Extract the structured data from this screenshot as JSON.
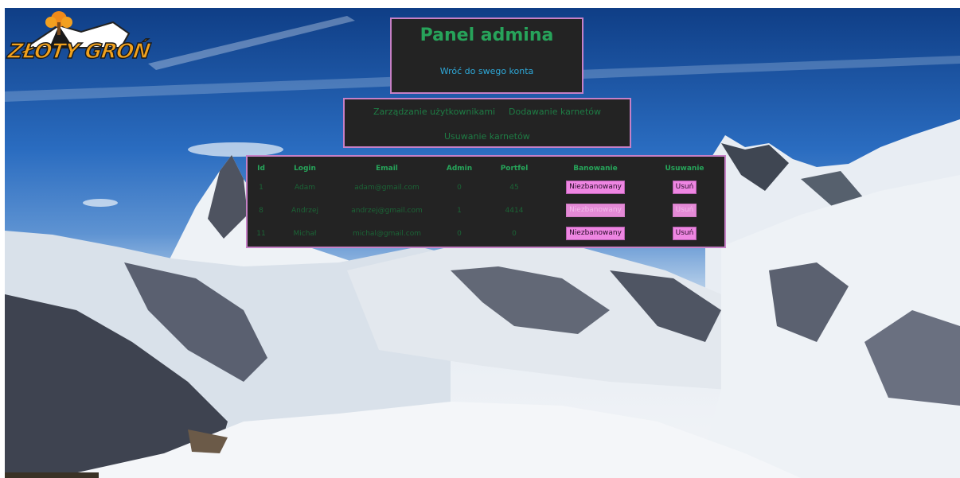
{
  "brand": {
    "logo_text": "ZŁOTY GROŃ"
  },
  "header": {
    "title": "Panel admina",
    "back_link": "Wróć do swego konta"
  },
  "nav": {
    "manage_users": "Zarządzanie użytkownikami",
    "add_passes": "Dodawanie karnetów",
    "remove_passes": "Usuwanie karnetów"
  },
  "table": {
    "columns": [
      "Id",
      "Login",
      "Email",
      "Admin",
      "Portfel",
      "Banowanie",
      "Usuwanie"
    ],
    "rows": [
      {
        "id": "1",
        "login": "Adam",
        "email": "adam@gmail.com",
        "admin": "0",
        "wallet": "45",
        "ban_label": "Niezbanowany",
        "delete_label": "Usuń"
      },
      {
        "id": "8",
        "login": "Andrzej",
        "email": "andrzej@gmail.com",
        "admin": "1",
        "wallet": "4414",
        "ban_label": "Niezbanowany",
        "delete_label": "Usuń"
      },
      {
        "id": "11",
        "login": "Michał",
        "email": "michal@gmail.com",
        "admin": "0",
        "wallet": "0",
        "ban_label": "Niezbanowany",
        "delete_label": "Usuń"
      }
    ]
  },
  "colors": {
    "panel_bg": "#232323",
    "panel_border": "#c680c6",
    "title_green": "#27a35a",
    "link_blue": "#2ea8d8",
    "button_pink": "#ee86e2"
  },
  "icons": {
    "logo_symbol": "tree-mountain-logo-icon"
  }
}
